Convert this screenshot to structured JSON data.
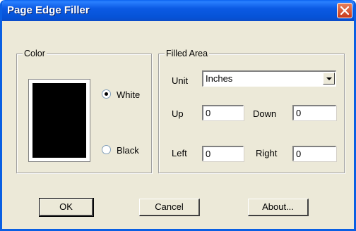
{
  "window": {
    "title": "Page Edge Filler"
  },
  "color_group": {
    "legend": "Color",
    "options": [
      {
        "label": "White",
        "selected": true
      },
      {
        "label": "Black",
        "selected": false
      }
    ]
  },
  "filled_area": {
    "legend": "Filled Area",
    "unit_label": "Unit",
    "unit_value": "Inches",
    "up_label": "Up",
    "up_value": "0",
    "down_label": "Down",
    "down_value": "0",
    "left_label": "Left",
    "left_value": "0",
    "right_label": "Right",
    "right_value": "0"
  },
  "buttons": {
    "ok": "OK",
    "cancel": "Cancel",
    "about": "About..."
  },
  "colors": {
    "titlebar": "#0a5fe3",
    "dialog_bg": "#ece9d8",
    "close_button": "#c9391a"
  }
}
